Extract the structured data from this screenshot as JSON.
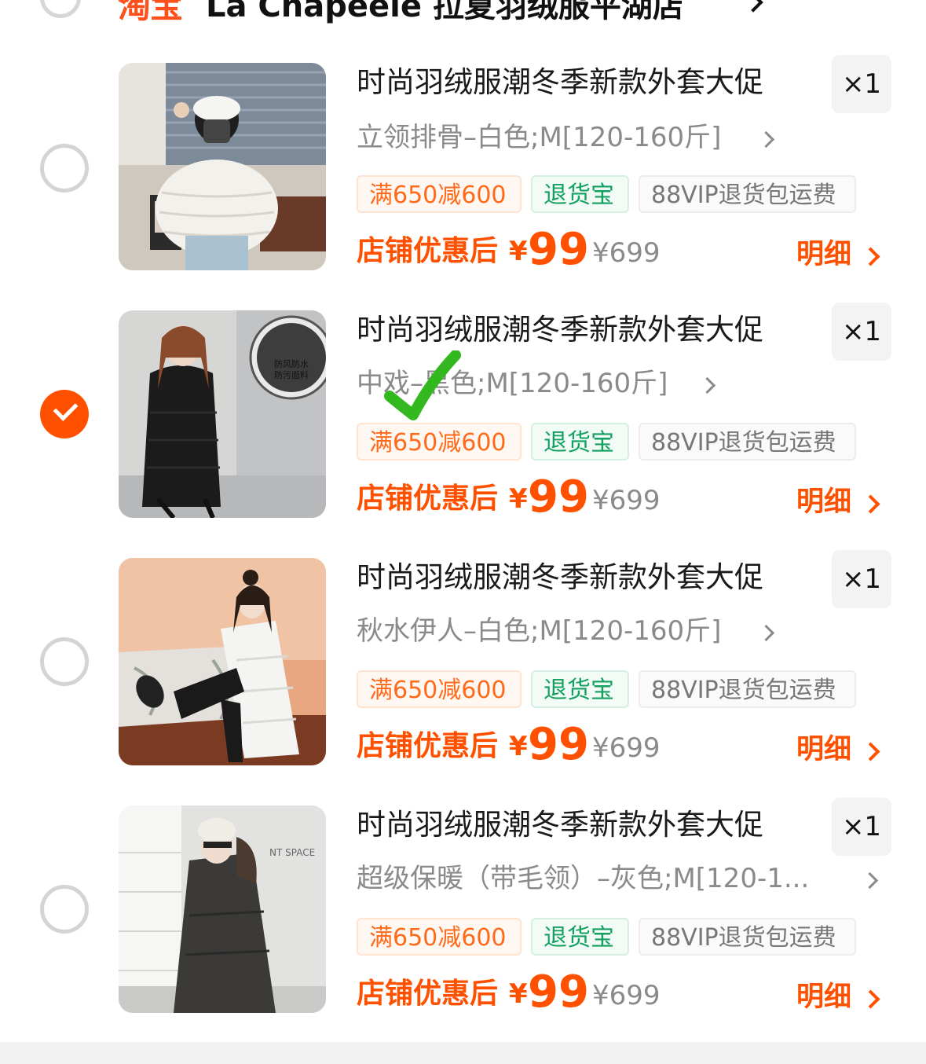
{
  "shop": {
    "platform": "淘宝",
    "name": "La Chapeele 拉夏羽绒服平湖店"
  },
  "items": [
    {
      "title": "时尚羽绒服潮冬季新款外套大促",
      "sku": "立领排骨–白色;M[120-160斤]",
      "qty": "×1",
      "selected": false,
      "tags": {
        "promo": "满650减600",
        "return": "退货宝",
        "vip": "88VIP退货包运费"
      },
      "price_label": "店铺优惠后",
      "price_symbol": "¥",
      "price": "99",
      "orig_price": "¥699",
      "detail": "明细"
    },
    {
      "title": "时尚羽绒服潮冬季新款外套大促",
      "sku": "中戏–黑色;M[120-160斤]",
      "qty": "×1",
      "selected": true,
      "tags": {
        "promo": "满650减600",
        "return": "退货宝",
        "vip": "88VIP退货包运费"
      },
      "price_label": "店铺优惠后",
      "price_symbol": "¥",
      "price": "99",
      "orig_price": "¥699",
      "detail": "明细",
      "image_text": [
        "防风防水",
        "防污面料"
      ]
    },
    {
      "title": "时尚羽绒服潮冬季新款外套大促",
      "sku": "秋水伊人–白色;M[120-160斤]",
      "qty": "×1",
      "selected": false,
      "tags": {
        "promo": "满650减600",
        "return": "退货宝",
        "vip": "88VIP退货包运费"
      },
      "price_label": "店铺优惠后",
      "price_symbol": "¥",
      "price": "99",
      "orig_price": "¥699",
      "detail": "明细"
    },
    {
      "title": "时尚羽绒服潮冬季新款外套大促",
      "sku": "超级保暖（带毛领）–灰色;M[120-1...",
      "qty": "×1",
      "selected": false,
      "tags": {
        "promo": "满650减600",
        "return": "退货宝",
        "vip": "88VIP退货包运费"
      },
      "price_label": "店铺优惠后",
      "price_symbol": "¥",
      "price": "99",
      "orig_price": "¥699",
      "detail": "明细",
      "image_text": "NT SPACE"
    }
  ],
  "colors": {
    "accent": "#ff5000",
    "return_green": "#14a060",
    "overlay_check": "#33b81f"
  }
}
